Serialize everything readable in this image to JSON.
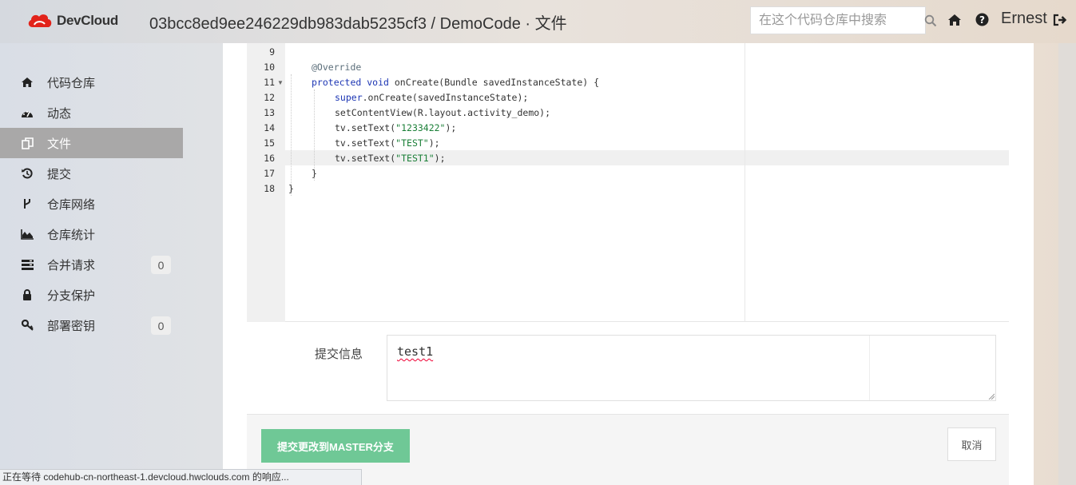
{
  "header": {
    "logo_text": "DevCloud",
    "repo_path": "03bcc8ed9ee246229db983dab5235cf3 / DemoCode · 文件",
    "search_placeholder": "在这个代码仓库中搜索",
    "user_name": "Ernest",
    "brand_color": "#e2231a"
  },
  "sidebar": {
    "items": [
      {
        "label": "代码仓库",
        "icon": "home-icon"
      },
      {
        "label": "动态",
        "icon": "dashboard-icon"
      },
      {
        "label": "文件",
        "icon": "files-icon",
        "active": true
      },
      {
        "label": "提交",
        "icon": "history-icon"
      },
      {
        "label": "仓库网络",
        "icon": "fork-icon"
      },
      {
        "label": "仓库统计",
        "icon": "area-chart-icon"
      },
      {
        "label": "合并请求",
        "icon": "merge-list-icon",
        "badge": "0"
      },
      {
        "label": "分支保护",
        "icon": "lock-icon"
      },
      {
        "label": "部署密钥",
        "icon": "key-icon",
        "badge": "0"
      }
    ]
  },
  "editor": {
    "line_numbers": [
      "9",
      "10",
      "11",
      "12",
      "13",
      "14",
      "15",
      "16",
      "17",
      "18"
    ],
    "lines": {
      "l10": "@Override",
      "l11_kw1": "protected",
      "l11_kw2": "void",
      "l11_rest": " onCreate(Bundle savedInstanceState) {",
      "l12_kw": "super",
      "l12_rest": ".onCreate(savedInstanceState);",
      "l13": "setContentView(R.layout.activity_demo);",
      "l14_pre": "tv.setText(",
      "l14_str": "\"1233422\"",
      "l14_post": ");",
      "l15_pre": "tv.setText(",
      "l15_str": "\"TEST\"",
      "l15_post": ");",
      "l16_pre": "tv.setText(",
      "l16_str": "\"TEST1\"",
      "l16_post": ");",
      "l17": "}",
      "l18": "}"
    }
  },
  "commit": {
    "label": "提交信息",
    "message": "test1",
    "submit_label": "提交更改到MASTER分支",
    "cancel_label": "取消",
    "submit_color": "#6fc896"
  },
  "status_bar": {
    "text": "正在等待 codehub-cn-northeast-1.devcloud.hwclouds.com 的响应..."
  }
}
